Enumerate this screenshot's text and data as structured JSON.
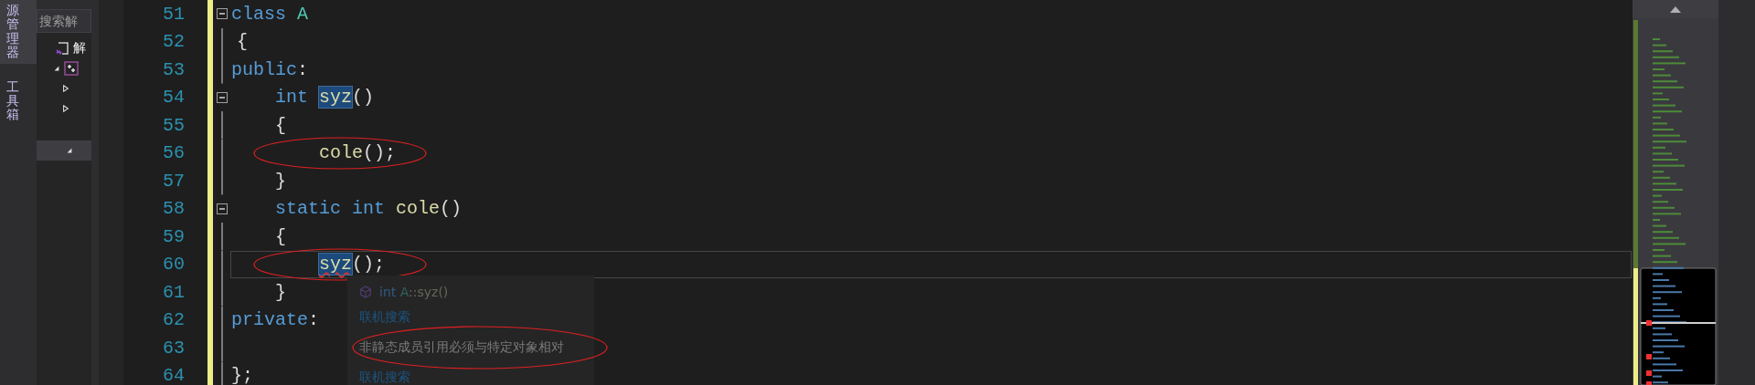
{
  "side_tabs": [
    {
      "label": "源管理器",
      "selected": true
    },
    {
      "label": "工具箱",
      "selected": false
    }
  ],
  "explorer": {
    "search": {
      "placeholder": "搜索解"
    },
    "tree": [
      {
        "label": "解",
        "kind": "solution",
        "children": [
          {
            "kind": "project",
            "expanded": true,
            "children": [
              {
                "expanded": false
              },
              {
                "expanded": false
              }
            ]
          }
        ]
      }
    ],
    "lower_panel": {
      "expanded": true
    }
  },
  "editor": {
    "lines": [
      {
        "number": "51",
        "kind": "flush",
        "fold": true,
        "current": false,
        "circled": false,
        "tokens": [
          {
            "text": "class ",
            "kind": "keyword"
          },
          {
            "text": "A",
            "kind": "type"
          }
        ]
      },
      {
        "number": "52",
        "kind": "brace",
        "fold": false,
        "current": false,
        "circled": false,
        "tokens": [
          {
            "text": "{",
            "kind": "plain"
          }
        ]
      },
      {
        "number": "53",
        "kind": "flush",
        "fold": false,
        "current": false,
        "circled": false,
        "tokens": [
          {
            "text": "public",
            "kind": "keyword"
          },
          {
            "text": ":",
            "kind": "plain"
          }
        ]
      },
      {
        "number": "54",
        "kind": "member",
        "fold": true,
        "current": false,
        "circled": false,
        "tokens": [
          {
            "text": "int ",
            "kind": "keyword"
          },
          {
            "text": "syz",
            "kind": "func",
            "highlighted": true,
            "error": false
          },
          {
            "text": "()",
            "kind": "plain"
          }
        ]
      },
      {
        "number": "55",
        "kind": "member",
        "fold": false,
        "current": false,
        "circled": false,
        "tokens": [
          {
            "text": "{",
            "kind": "plain"
          }
        ]
      },
      {
        "number": "56",
        "kind": "body",
        "fold": false,
        "current": false,
        "circled": true,
        "tokens": [
          {
            "text": "cole",
            "kind": "func"
          },
          {
            "text": "();",
            "kind": "plain"
          }
        ]
      },
      {
        "number": "57",
        "kind": "member",
        "fold": false,
        "current": false,
        "circled": false,
        "tokens": [
          {
            "text": "}",
            "kind": "plain"
          }
        ]
      },
      {
        "number": "58",
        "kind": "member",
        "fold": true,
        "current": false,
        "circled": false,
        "tokens": [
          {
            "text": "static int ",
            "kind": "keyword"
          },
          {
            "text": "cole",
            "kind": "func"
          },
          {
            "text": "()",
            "kind": "plain"
          }
        ]
      },
      {
        "number": "59",
        "kind": "member",
        "fold": false,
        "current": false,
        "circled": false,
        "tokens": [
          {
            "text": "{",
            "kind": "plain"
          }
        ]
      },
      {
        "number": "60",
        "kind": "body",
        "fold": false,
        "current": true,
        "circled": true,
        "tokens": [
          {
            "text": "syz",
            "kind": "func",
            "highlighted": true,
            "error": true
          },
          {
            "text": "();",
            "kind": "plain"
          }
        ]
      },
      {
        "number": "61",
        "kind": "member",
        "fold": false,
        "current": false,
        "circled": false,
        "tokens": [
          {
            "text": "}",
            "kind": "plain"
          }
        ]
      },
      {
        "number": "62",
        "kind": "flush",
        "fold": false,
        "current": false,
        "circled": false,
        "tokens": [
          {
            "text": "private",
            "kind": "keyword"
          },
          {
            "text": ":",
            "kind": "plain"
          }
        ]
      },
      {
        "number": "63",
        "kind": "flush",
        "fold": false,
        "current": false,
        "circled": false
      },
      {
        "number": "64",
        "kind": "flush",
        "fold": false,
        "current": false,
        "circled": false,
        "tokens": [
          {
            "text": "};",
            "kind": "plain"
          }
        ]
      }
    ]
  },
  "tooltip": {
    "signature": [
      {
        "text": "int ",
        "kind": "keyword"
      },
      {
        "text": "A",
        "kind": "type"
      },
      {
        "text": "::syz()",
        "kind": "plain"
      }
    ],
    "rows": [
      {
        "kind": "link",
        "text": "联机搜索",
        "circled": false
      },
      {
        "kind": "message",
        "text": "非静态成员引用必须与特定对象相对",
        "circled": true
      },
      {
        "kind": "link",
        "text": "联机搜索",
        "circled": false
      }
    ]
  }
}
